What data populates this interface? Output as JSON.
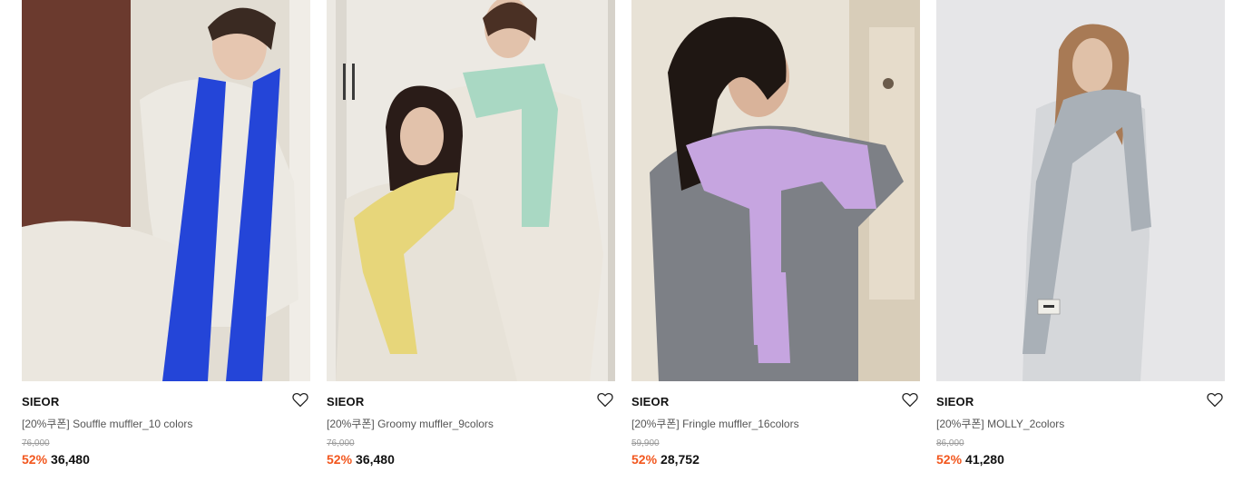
{
  "products": [
    {
      "brand": "SIEOR",
      "name": "[20%쿠폰] Souffle muffler_10 colors",
      "original_price": "76,000",
      "discount": "52%",
      "price": "36,480",
      "image_icon": "scarf-photo-blue",
      "colors": {
        "bg": "#d9d4cb",
        "scarf": "#2445d8",
        "sweater": "#ece9e2"
      }
    },
    {
      "brand": "SIEOR",
      "name": "[20%쿠폰] Groomy muffler_9colors",
      "original_price": "76,000",
      "discount": "52%",
      "price": "36,480",
      "image_icon": "scarf-photo-yellow-mint",
      "colors": {
        "bg": "#ece9e3",
        "scarf": "#e7d67a",
        "scarf2": "#a9d8c3",
        "sweater": "#ebe6dd"
      }
    },
    {
      "brand": "SIEOR",
      "name": "[20%쿠폰] Fringle muffler_16colors",
      "original_price": "59,900",
      "discount": "52%",
      "price": "28,752",
      "image_icon": "scarf-photo-lilac",
      "colors": {
        "bg": "#e8e2d6",
        "scarf": "#c6a5e0",
        "sweater": "#7d8086"
      }
    },
    {
      "brand": "SIEOR",
      "name": "[20%쿠폰] MOLLY_2colors",
      "original_price": "86,000",
      "discount": "52%",
      "price": "41,280",
      "image_icon": "scarf-photo-grey",
      "colors": {
        "bg": "#e6e6e8",
        "scarf": "#a9b0b7",
        "sweater": "#d5d7da"
      }
    }
  ]
}
